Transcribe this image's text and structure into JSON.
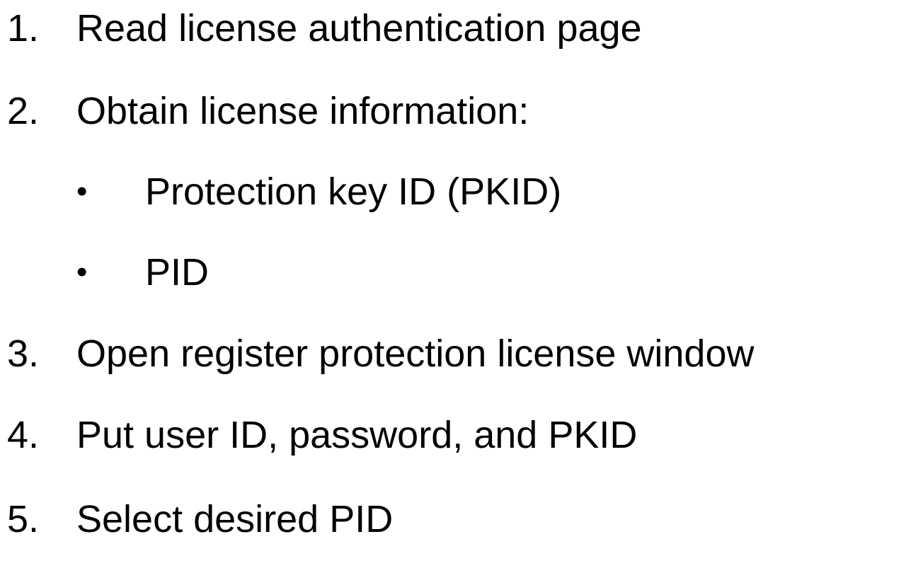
{
  "steps": [
    {
      "number": "1.",
      "text": "Read license authentication page"
    },
    {
      "number": "2.",
      "text": "Obtain license information:",
      "subitems": [
        {
          "bullet": "•",
          "text": "Protection key ID (PKID)"
        },
        {
          "bullet": "•",
          "text": "PID"
        }
      ]
    },
    {
      "number": "3.",
      "text": "Open register protection license window"
    },
    {
      "number": "4.",
      "text": "Put user ID, password, and PKID"
    },
    {
      "number": "5.",
      "text": "Select desired PID"
    }
  ]
}
